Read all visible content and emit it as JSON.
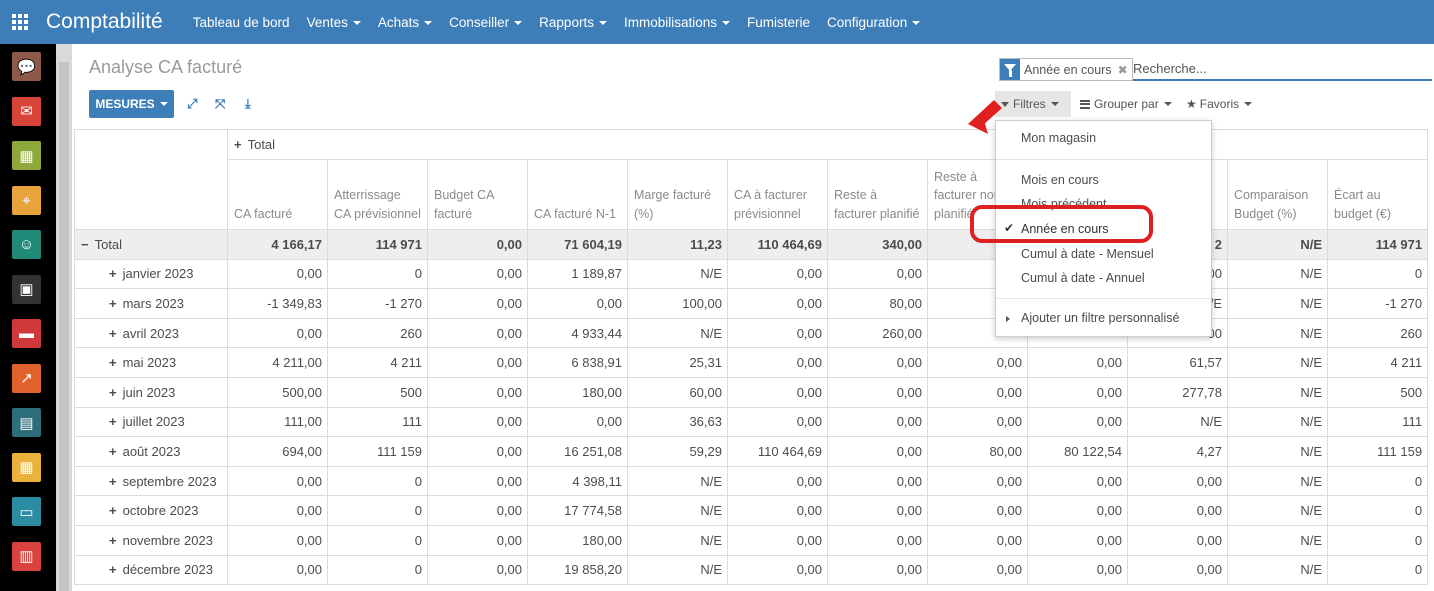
{
  "app": {
    "title": "Comptabilité",
    "menu": [
      {
        "label": "Tableau de bord",
        "dropdown": false
      },
      {
        "label": "Ventes",
        "dropdown": true
      },
      {
        "label": "Achats",
        "dropdown": true
      },
      {
        "label": "Conseiller",
        "dropdown": true
      },
      {
        "label": "Rapports",
        "dropdown": true
      },
      {
        "label": "Immobilisations",
        "dropdown": true
      },
      {
        "label": "Fumisterie",
        "dropdown": false
      },
      {
        "label": "Configuration",
        "dropdown": true
      }
    ]
  },
  "dock": {
    "apps": [
      {
        "icon": "discuss-icon",
        "color": "#8d5a4a"
      },
      {
        "icon": "mail-icon",
        "color": "#d6443a"
      },
      {
        "icon": "calendar-icon",
        "color": "#8ea93a"
      },
      {
        "icon": "map-pin-icon",
        "color": "#e8a33d"
      },
      {
        "icon": "contacts-icon",
        "color": "#1f8a78"
      },
      {
        "icon": "inventory-icon",
        "color": "#333333"
      },
      {
        "icon": "folder-icon",
        "color": "#d0393b"
      },
      {
        "icon": "chart-icon",
        "color": "#e0632d"
      },
      {
        "icon": "document-icon",
        "color": "#2c6e79"
      },
      {
        "icon": "calculator-icon",
        "color": "#e9b23b"
      },
      {
        "icon": "card-icon",
        "color": "#2b8ca3"
      },
      {
        "icon": "building-icon",
        "color": "#d9423e"
      }
    ]
  },
  "control": {
    "page_title": "Analyse CA facturé",
    "mesures_label": "MESURES",
    "search": {
      "facet_label": "Année en cours",
      "placeholder": "Recherche..."
    },
    "filtres_label": "Filtres",
    "grouper_label": "Grouper par",
    "favoris_label": "Favoris"
  },
  "filter_menu": {
    "items": [
      {
        "label": "Mon magasin",
        "checked": false
      },
      {
        "label": "Mois en cours",
        "checked": false
      },
      {
        "label": "Mois précédent",
        "checked": false
      },
      {
        "label": "Année en cours",
        "checked": true
      },
      {
        "label": "Cumul à date - Mensuel",
        "checked": false
      },
      {
        "label": "Cumul à date - Annuel",
        "checked": false
      }
    ],
    "custom_filter_label": "Ajouter un filtre personnalisé"
  },
  "pivot": {
    "col_total_label": "Total",
    "measures": [
      "CA facturé",
      "Atterrissage CA prévisionnel",
      "Budget CA facturé",
      "CA facturé N-1",
      "Marge facturé (%)",
      "CA à facturer prévisionnel",
      "Reste à facturer planifié",
      "Reste à facturer non planifié",
      "",
      "",
      "Comparaison Budget (%)",
      "Écart au budget (€)"
    ],
    "rows": [
      {
        "label": "Total",
        "is_total": true,
        "values": [
          "4 166,17",
          "114 971",
          "0,00",
          "71 604,19",
          "11,23",
          "110 464,69",
          "340,00",
          "0",
          "",
          "2",
          "N/E",
          "114 971"
        ]
      },
      {
        "label": "janvier 2023",
        "values": [
          "0,00",
          "0",
          "0,00",
          "1 189,87",
          "N/E",
          "0,00",
          "0,00",
          "",
          "",
          "00",
          "N/E",
          "0"
        ]
      },
      {
        "label": "mars 2023",
        "values": [
          "-1 349,83",
          "-1 270",
          "0,00",
          "0,00",
          "100,00",
          "0,00",
          "80,00",
          "",
          "",
          "/E",
          "N/E",
          "-1 270"
        ]
      },
      {
        "label": "avril 2023",
        "values": [
          "0,00",
          "260",
          "0,00",
          "4 933,44",
          "N/E",
          "0,00",
          "260,00",
          "",
          "",
          "00",
          "N/E",
          "260"
        ]
      },
      {
        "label": "mai 2023",
        "values": [
          "4 211,00",
          "4 211",
          "0,00",
          "6 838,91",
          "25,31",
          "0,00",
          "0,00",
          "0,00",
          "0,00",
          "61,57",
          "N/E",
          "4 211"
        ]
      },
      {
        "label": "juin 2023",
        "values": [
          "500,00",
          "500",
          "0,00",
          "180,00",
          "60,00",
          "0,00",
          "0,00",
          "0,00",
          "0,00",
          "277,78",
          "N/E",
          "500"
        ]
      },
      {
        "label": "juillet 2023",
        "values": [
          "111,00",
          "111",
          "0,00",
          "0,00",
          "36,63",
          "0,00",
          "0,00",
          "0,00",
          "0,00",
          "N/E",
          "N/E",
          "111"
        ]
      },
      {
        "label": "août 2023",
        "values": [
          "694,00",
          "111 159",
          "0,00",
          "16 251,08",
          "59,29",
          "110 464,69",
          "0,00",
          "80,00",
          "80 122,54",
          "4,27",
          "N/E",
          "111 159"
        ]
      },
      {
        "label": "septembre 2023",
        "values": [
          "0,00",
          "0",
          "0,00",
          "4 398,11",
          "N/E",
          "0,00",
          "0,00",
          "0,00",
          "0,00",
          "0,00",
          "N/E",
          "0"
        ]
      },
      {
        "label": "octobre 2023",
        "values": [
          "0,00",
          "0",
          "0,00",
          "17 774,58",
          "N/E",
          "0,00",
          "0,00",
          "0,00",
          "0,00",
          "0,00",
          "N/E",
          "0"
        ]
      },
      {
        "label": "novembre 2023",
        "values": [
          "0,00",
          "0",
          "0,00",
          "180,00",
          "N/E",
          "0,00",
          "0,00",
          "0,00",
          "0,00",
          "0,00",
          "N/E",
          "0"
        ]
      },
      {
        "label": "décembre 2023",
        "values": [
          "0,00",
          "0",
          "0,00",
          "19 858,20",
          "N/E",
          "0,00",
          "0,00",
          "0,00",
          "0,00",
          "0,00",
          "N/E",
          "0"
        ]
      }
    ]
  },
  "colors": {
    "primary": "#3d7eb9",
    "highlight": "#e02020"
  }
}
